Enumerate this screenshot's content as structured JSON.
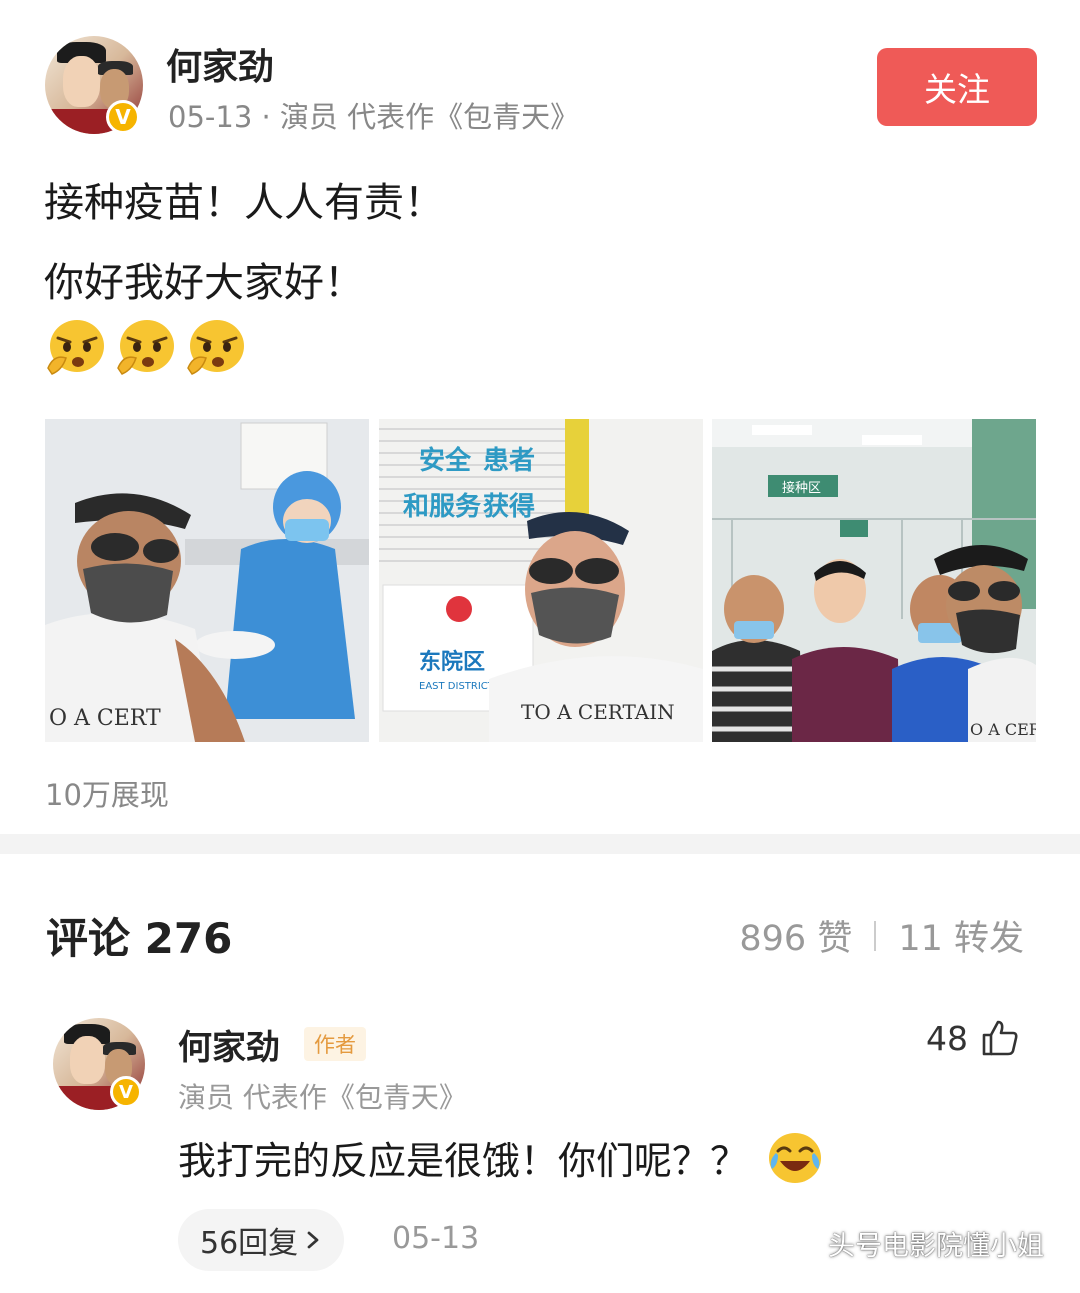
{
  "post": {
    "author_name": "何家劲",
    "meta": "05-13 · 演员 代表作《包青天》",
    "follow_label": "关注",
    "lines": [
      "接种疫苗！人人有责！",
      "你好我好大家好！"
    ],
    "emoji_count": 3,
    "emoji_icon": "angry-thinking-face-emoji",
    "impressions": "10万展现"
  },
  "photos": {
    "photo1_caption": "O A CERT",
    "photo2_sign_lines": [
      "安全",
      "和服务",
      "患者",
      "获得"
    ],
    "photo2_hospital": "东院区",
    "photo2_district": "EAST DISTRICT",
    "photo2_shirt": "TO A CERTAIN",
    "photo3_sign": "接种区",
    "photo3_shirt": "O A CERTA"
  },
  "comments_header": {
    "title": "评论 276",
    "likes": "896 赞",
    "reposts": "11 转发"
  },
  "comment": {
    "name": "何家劲",
    "author_tag": "作者",
    "meta": "演员 代表作《包青天》",
    "text": "我打完的反应是很饿！你们呢？？",
    "like_count": "48",
    "reply_label": "56回复",
    "date": "05-13"
  },
  "watermark": {
    "text": "头号电影院懂小姐"
  },
  "colors": {
    "follow_button": "#ef5a57",
    "verified_badge": "#f6b400",
    "author_tag_text": "#e49a3f",
    "muted_text": "#888888"
  }
}
